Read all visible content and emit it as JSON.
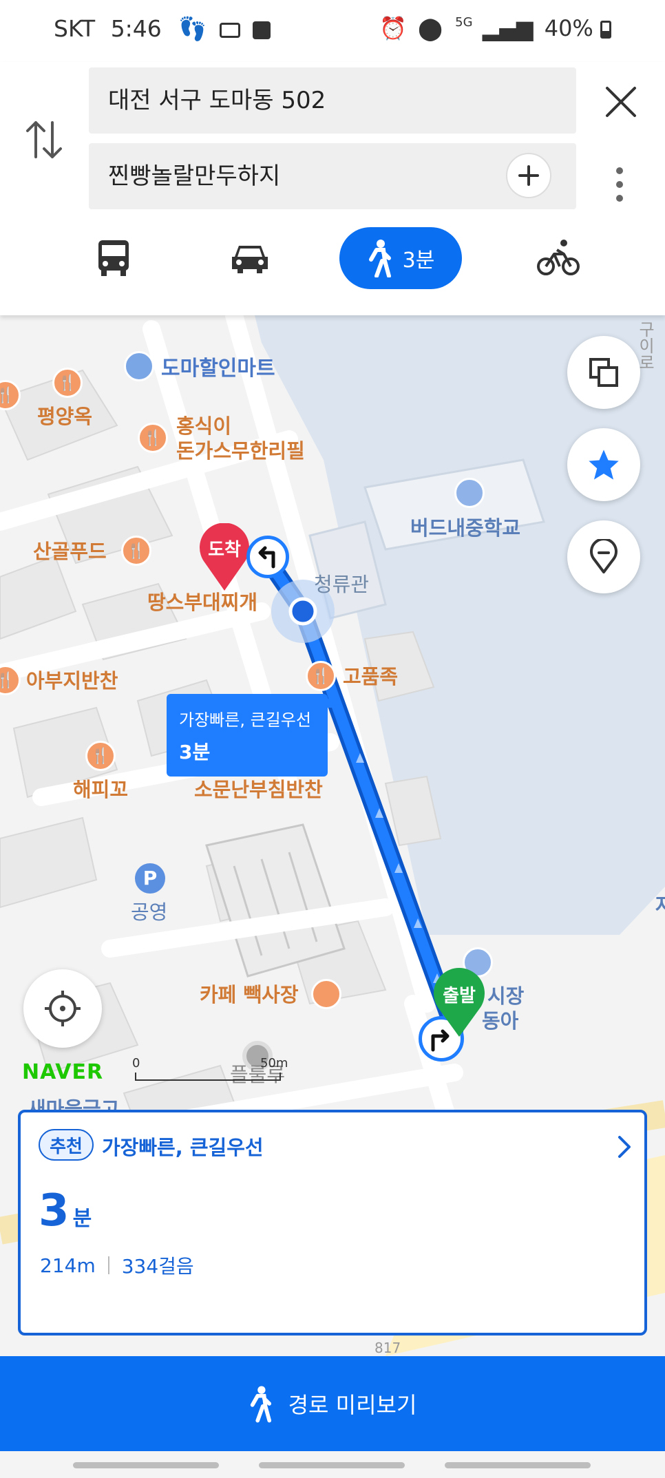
{
  "status_bar": {
    "carrier": "SKT",
    "time": "5:46",
    "network": "5G",
    "battery": "40%"
  },
  "search": {
    "origin": "대전 서구 도마동 502",
    "destination": "찐빵놀랄만두하지"
  },
  "modes": {
    "walk_time": "3분"
  },
  "map": {
    "pois": {
      "mart": "도마할인마트",
      "pyeongyang": "평양옥",
      "hongsik1": "홍식이",
      "hongsik2": "돈가스무한리필",
      "sangol": "산골푸드",
      "ttangsu": "땅스부대찌개",
      "abuji": "아부지반찬",
      "happy": "해피꼬",
      "somun": "소문난부침반찬",
      "gopum": "고품족",
      "school": "버드내중학교",
      "cheongryu": "청류관",
      "gongyeong": "공영",
      "cafe": "카페 빽사장",
      "pulleolu": "플룰루",
      "market1": "시장",
      "market2": "동아",
      "road_partial": "구이로",
      "partial_bottom": "새마을금고",
      "partial_right": "자"
    },
    "arrival_label": "도착",
    "departure_label": "출발",
    "route_tip": {
      "title": "가장빠른, 큰길우선",
      "time": "3분"
    },
    "scale": {
      "zero": "0",
      "distance": "50m"
    },
    "brand": "NAVER",
    "bottom_num": "817"
  },
  "route_card": {
    "badge": "추천",
    "title": "가장빠른, 큰길우선",
    "time_number": "3",
    "time_unit": "분",
    "distance": "214m",
    "steps": "334걸음"
  },
  "preview_button": "경로 미리보기",
  "colors": {
    "accent": "#0a6ff0",
    "arrival": "#e8344e",
    "departure": "#1ea84a",
    "poi": "#f39a66"
  }
}
